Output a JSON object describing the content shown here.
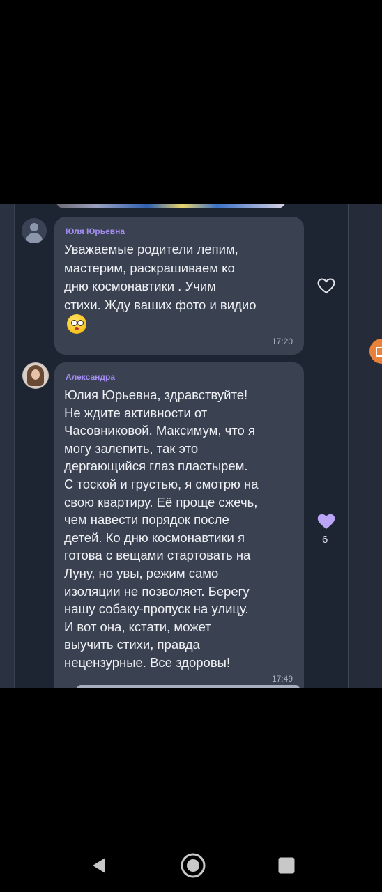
{
  "chat": {
    "messages": [
      {
        "sender": "Юля Юрьевна",
        "text": "Уважаемые родители лепим,\nмастерим, раскрашиваем ко\nдню космонавтики . Учим\nстихи. Жду ваших фото и видио",
        "emoji": "dizzy-face-emoji",
        "time": "17:20",
        "likes": "",
        "liked": false,
        "avatar": "default-user-avatar"
      },
      {
        "sender": "Александра",
        "text": "Юлия Юрьевна, здравствуйте!\nНе ждите активности от\nЧасовниковой. Максимум, что я\nмогу залепить, так это\nдергающийся глаз пластырем.\nС тоской и грустью, я смотрю на\nсвою квартиру. Её проще сжечь,\nчем навести порядок после\nдетей. Ко дню космонавтики я\nготова с вещами стартовать на\nЛуну, но увы, режим само\nизоляции не позволяет. Берегу\nнашу собаку-пропуск на улицу.\nИ вот она, кстати, может\nвыучить стихи, правда\nнецензурные. Все здоровы!",
        "time": "17:49",
        "likes": "6",
        "liked": true,
        "avatar": "user-photo-avatar"
      }
    ],
    "colors": {
      "background": "#1e2532",
      "bubble": "#3a4252",
      "sender_name": "#a48cf0",
      "like_filled": "#b9a4f5",
      "accent_orange": "#e9813a"
    }
  },
  "navbar": {
    "icons": [
      "back-icon",
      "home-icon",
      "recent-apps-icon"
    ]
  }
}
